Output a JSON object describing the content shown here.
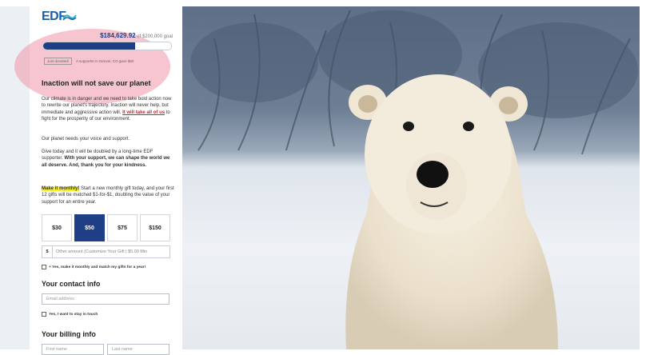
{
  "logo": {
    "text": "EDF"
  },
  "goal": {
    "amount": "$184,629.92",
    "suffix": "of $200,000 goal",
    "progress_fraction": 0.72
  },
  "recent": {
    "badge": "Just donated!",
    "text": "A supporter in Denver, CO gave $50"
  },
  "headline": "Inaction will not save our planet",
  "body": {
    "p1_a": "Our climate is in danger and we need to take bold action now to rewrite our planet's trajectory. Inaction will never help, but immediate and aggressive action will.",
    "p1_link": "It will take all of us",
    "p1_b": "to fight for the prosperity of our environment.",
    "p2": "Our planet needs your voice and support.",
    "p3_a": "Give today and it will be doubled by a long-time EDF supporter.",
    "p3_bold": "With your support, we can shape the world we all deserve. And, thank you for your kindness.",
    "p4_highlight": "Make it monthly!",
    "p4_rest": "Start a new monthly gift today, and your first 12 gifts will be matched $1-for-$1, doubling the value of your support for an entire year."
  },
  "amounts": [
    {
      "label": "$30",
      "selected": false
    },
    {
      "label": "$50",
      "selected": true
    },
    {
      "label": "$75",
      "selected": false
    },
    {
      "label": "$150",
      "selected": false
    }
  ],
  "other_amount": {
    "prefix": "$",
    "placeholder": "Other amount (Customize Your Gift | $5.00 Min"
  },
  "monthly_checkbox_label": "+ Yes, make it monthly and match my gifts for a year!",
  "contact": {
    "heading": "Your contact info",
    "email_placeholder": "Email address",
    "stay_in_touch_label": "Yes, I want to stay in touch"
  },
  "billing": {
    "heading": "Your billing info",
    "first_placeholder": "First name",
    "last_placeholder": "Last name"
  },
  "colors": {
    "brand_blue": "#1e3e86",
    "link_red": "#c1272d",
    "highlight_yellow": "#f6f02a",
    "annotation_pink": "#f096aa"
  }
}
